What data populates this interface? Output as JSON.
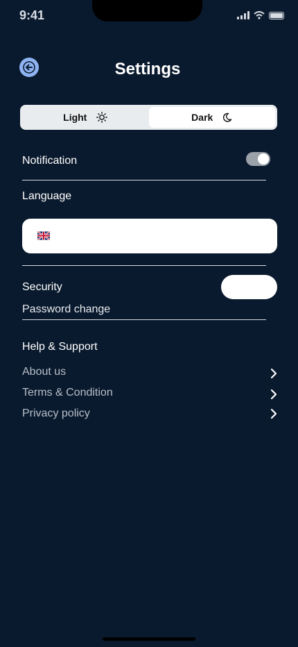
{
  "status_bar": {
    "time": "9:41"
  },
  "header": {
    "title": "Settings"
  },
  "theme": {
    "light_label": "Light",
    "dark_label": "Dark",
    "selected": "Dark"
  },
  "notification": {
    "label": "Notification",
    "enabled": true
  },
  "language": {
    "label": "Language",
    "flag_icon": "uk-flag-icon"
  },
  "security": {
    "label": "Security",
    "password_change": "Password change"
  },
  "help": {
    "heading": "Help & Support",
    "items": [
      {
        "label": "About us"
      },
      {
        "label": "Terms & Condition"
      },
      {
        "label": "Privacy policy"
      }
    ]
  },
  "colors": {
    "background": "#0a1a2e",
    "accent": "#8fb3f2"
  }
}
